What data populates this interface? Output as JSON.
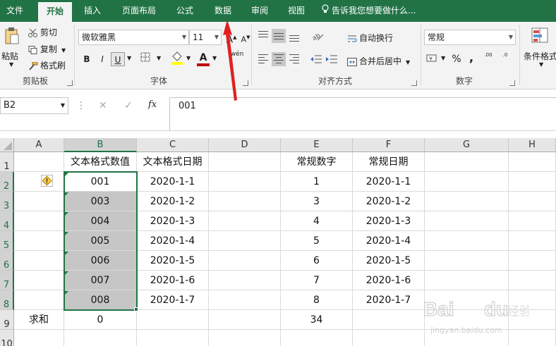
{
  "ribbon_tabs": [
    {
      "label": "文件"
    },
    {
      "label": "开始"
    },
    {
      "label": "插入"
    },
    {
      "label": "页面布局"
    },
    {
      "label": "公式"
    },
    {
      "label": "数据"
    },
    {
      "label": "审阅"
    },
    {
      "label": "视图"
    }
  ],
  "tell_me": "告诉我您想要做什么...",
  "clipboard": {
    "paste": "粘贴",
    "cut": "剪切",
    "copy": "复制",
    "format_painter": "格式刷",
    "group": "剪贴板"
  },
  "font": {
    "name": "微软雅黑",
    "size": "11",
    "bold": "B",
    "italic": "I",
    "underline": "U",
    "grow": "A",
    "shrink": "A",
    "font_color": "A",
    "phonetic": "wén",
    "group": "字体"
  },
  "alignment": {
    "wrap_text": "自动换行",
    "merge_center": "合并后居中",
    "group": "对齐方式"
  },
  "number": {
    "format": "常规",
    "percent": "%",
    "comma": ",",
    "inc_decimal": ".00",
    "dec_decimal": ".0",
    "group": "数字"
  },
  "styles": {
    "conditional": "条件格式"
  },
  "formula_bar": {
    "name_box": "B2",
    "cancel": "✕",
    "enter": "✓",
    "fx": "fx",
    "content": "001"
  },
  "accent_color": "#217346",
  "columns": [
    "A",
    "B",
    "C",
    "D",
    "E",
    "F",
    "G",
    "H"
  ],
  "rows": [
    "1",
    "2",
    "3",
    "4",
    "5",
    "6",
    "7",
    "8",
    "9",
    "10"
  ],
  "cells": {
    "B1": "文本格式数值",
    "C1": "文本格式日期",
    "E1": "常规数字",
    "F1": "常规日期",
    "B2": "001",
    "C2": "2020-1-1",
    "E2": "1",
    "F2": "2020-1-1",
    "B3": "003",
    "C3": "2020-1-2",
    "E3": "3",
    "F3": "2020-1-2",
    "B4": "004",
    "C4": "2020-1-3",
    "E4": "4",
    "F4": "2020-1-3",
    "B5": "005",
    "C5": "2020-1-4",
    "E5": "5",
    "F5": "2020-1-4",
    "B6": "006",
    "C6": "2020-1-5",
    "E6": "6",
    "F6": "2020-1-5",
    "B7": "007",
    "C7": "2020-1-6",
    "E7": "7",
    "F7": "2020-1-6",
    "B8": "008",
    "C8": "2020-1-7",
    "E8": "8",
    "F8": "2020-1-7",
    "A9": "求和",
    "B9": "0",
    "E9": "34"
  },
  "watermark": {
    "brand": "Baidu经验",
    "url": "jingyan.baidu.com"
  }
}
